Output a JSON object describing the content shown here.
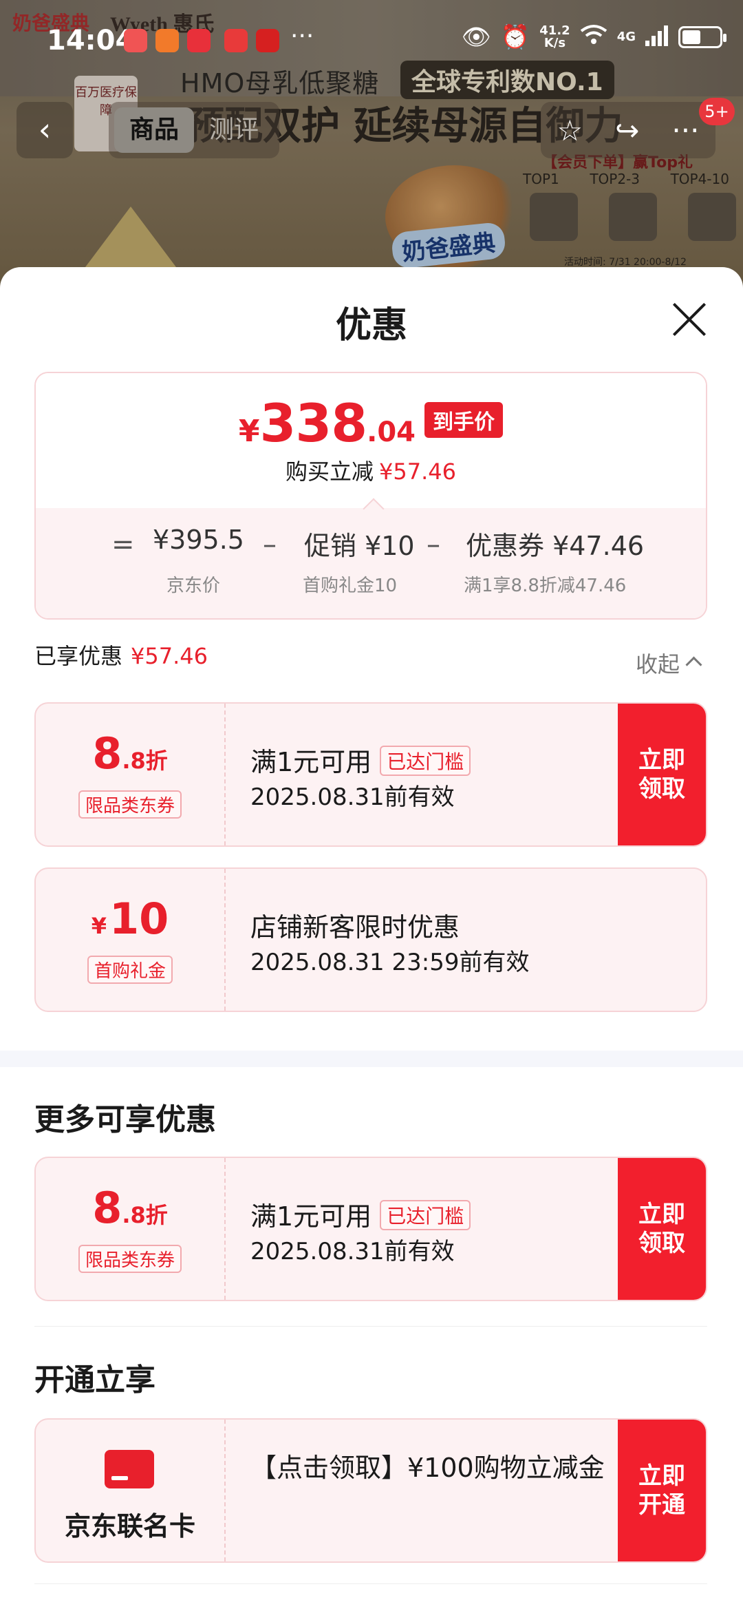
{
  "status_bar": {
    "time": "14:04",
    "more": "···",
    "speed_value": "41.2",
    "speed_unit": "K/s",
    "network": "4G",
    "battery_level": 0.5
  },
  "background": {
    "logo_text": "奶爸盛典",
    "brand": "Wyeth 惠氏",
    "headline": "HMO母乳低聚糖",
    "headline_badge": "全球专利数NO.1",
    "slogan": "预配双护 延续母源自御力",
    "badge_left": "百万医疗保障",
    "cartoon_label": "奶爸盛典",
    "promo_line": "【会员下单】赢Top礼",
    "tops": [
      "TOP1",
      "TOP2-3",
      "TOP4-10"
    ],
    "footnote": "活动时间: 7/31 20:00-8/12"
  },
  "nav": {
    "tabs": [
      "商品",
      "测评"
    ],
    "badge": "5+"
  },
  "sheet": {
    "title": "优惠",
    "price": {
      "yen": "¥",
      "integer": "338",
      "decimal": ".04",
      "tag": "到手价",
      "sub_label": "购买立减",
      "sub_value": "¥57.46"
    },
    "calc": {
      "eq": "=",
      "minus": "–",
      "jd_price": "¥395.5",
      "jd_price_label": "京东价",
      "promo": "促销 ¥10",
      "promo_label": "首购礼金10",
      "coupon": "优惠券 ¥47.46",
      "coupon_label": "满1享8.8折减47.46"
    },
    "enjoyed": {
      "label": "已享优惠",
      "value": "¥57.46",
      "collapse": "收起"
    },
    "coupons": [
      {
        "big_main": "8",
        "big_sub": ".8折",
        "tag": "限品类东券",
        "line1": "满1元可用",
        "reached": "已达门槛",
        "line2": "2025.08.31前有效",
        "action": "立即领取"
      },
      {
        "yen": "¥",
        "big_main": "10",
        "tag": "首购礼金",
        "line1": "店铺新客限时优惠",
        "line2": "2025.08.31 23:59前有效"
      }
    ],
    "more_title": "更多可享优惠",
    "more_coupon": {
      "big_main": "8",
      "big_sub": ".8折",
      "tag": "限品类东券",
      "line1": "满1元可用",
      "reached": "已达门槛",
      "line2": "2025.08.31前有效",
      "action": "立即领取"
    },
    "open_title": "开通立享",
    "open_card": {
      "icon": "credit-card-icon",
      "name": "京东联名卡",
      "text": "【点击领取】¥100购物立减金",
      "action": "立即开通"
    }
  }
}
